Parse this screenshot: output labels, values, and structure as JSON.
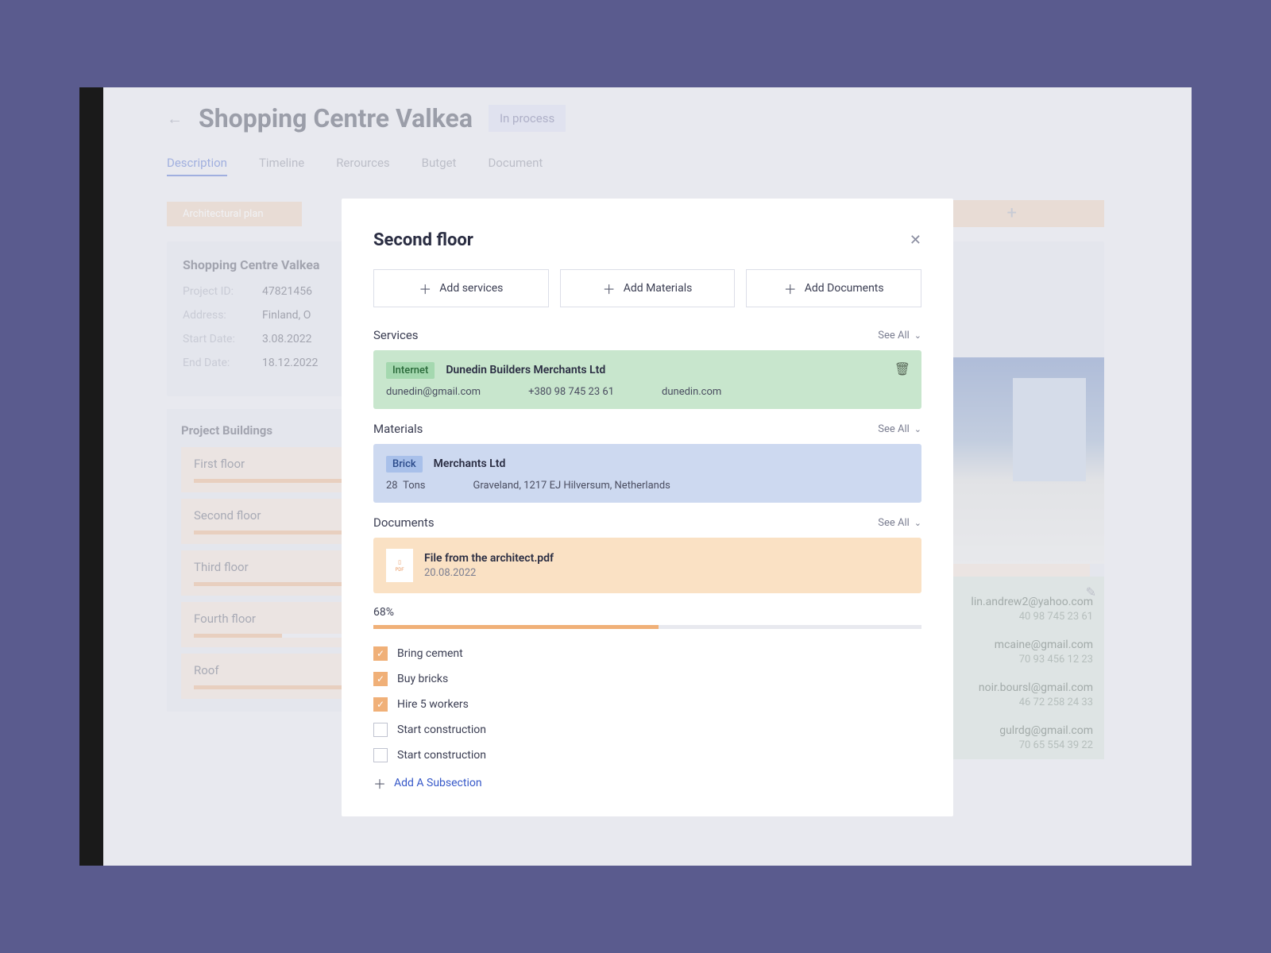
{
  "header": {
    "title": "Shopping Centre Valkea",
    "status": "In process"
  },
  "tabs": [
    "Description",
    "Timeline",
    "Rerources",
    "Butget",
    "Document"
  ],
  "phaseLabel": "Architectural plan",
  "info": {
    "title": "Shopping Centre Valkea",
    "projectId": "47821456",
    "address": "Finland, O",
    "startDate": "3.08.2022",
    "endDate": "18.12.2022",
    "labels": {
      "projectId": "Project ID:",
      "address": "Address:",
      "startDate": "Start Date:",
      "endDate": "End Date:"
    }
  },
  "buildings": {
    "title": "Project Buildings",
    "items": [
      {
        "name": "First floor",
        "progress": 68
      },
      {
        "name": "Second floor",
        "progress": 42
      },
      {
        "name": "Third floor",
        "progress": 62
      },
      {
        "name": "Fourth floor",
        "progress": 10
      },
      {
        "name": "Roof",
        "progress": 20
      }
    ]
  },
  "contacts": [
    {
      "email": "lin.andrew2@yahoo.com",
      "phone": "40 98 745 23 61"
    },
    {
      "email": "mcaine@gmail.com",
      "phone": "70 93 456 12 23"
    },
    {
      "email": "noir.boursl@gmail.com",
      "phone": "46 72 258 24 33"
    },
    {
      "email": "gulrdg@gmail.com",
      "phone": "70 65 554 39 22"
    }
  ],
  "modal": {
    "title": "Second floor",
    "addButtons": [
      "Add services",
      "Add Materials",
      "Add Documents"
    ],
    "sections": {
      "services": {
        "label": "Services",
        "seeAll": "See All"
      },
      "materials": {
        "label": "Materials",
        "seeAll": "See All"
      },
      "documents": {
        "label": "Documents",
        "seeAll": "See All"
      }
    },
    "service": {
      "tag": "Internet",
      "company": "Dunedin Builders Merchants Ltd",
      "email": "dunedin@gmail.com",
      "phone": "+380 98 745 23 61",
      "site": "dunedin.com"
    },
    "material": {
      "tag": "Brick",
      "company": "Merchants Ltd",
      "qty": "28",
      "unit": "Tons",
      "address": "Graveland, 1217 EJ Hilversum, Netherlands"
    },
    "document": {
      "name": "File from the architect.pdf",
      "date": "20.08.2022"
    },
    "progress": {
      "label": "68%",
      "value": 52
    },
    "tasks": [
      {
        "label": "Bring cement",
        "done": true
      },
      {
        "label": "Buy bricks",
        "done": true
      },
      {
        "label": "Hire 5 workers",
        "done": true
      },
      {
        "label": "Start construction",
        "done": false
      },
      {
        "label": "Start construction",
        "done": false
      }
    ],
    "addSubsection": "Add A Subsection"
  }
}
